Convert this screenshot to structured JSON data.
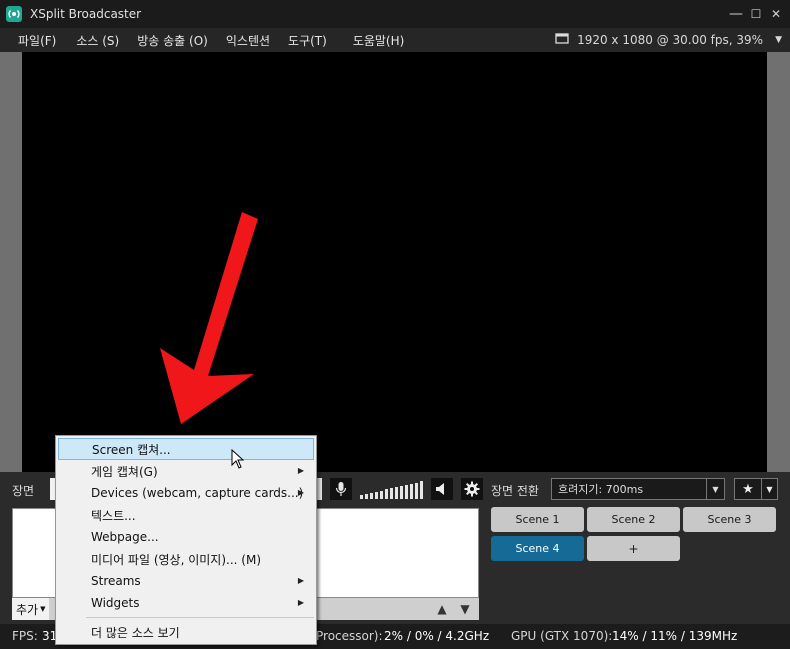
{
  "window": {
    "title": "XSplit Broadcaster",
    "controls": {
      "minimize": "—",
      "maximize": "☐",
      "close": "✕"
    }
  },
  "menu": {
    "items": [
      "파일(F)",
      "소스 (S)",
      "방송 송출 (O)",
      "익스텐션",
      "도구(T)",
      "도움말(H)"
    ],
    "resolution": "1920 x 1080 @ 30.00 fps, 39%"
  },
  "scenes": {
    "label": "장면",
    "buttons": [
      "Scene 1",
      "Scene 2",
      "Scene 3",
      "Scene 4",
      "+"
    ],
    "active": "Scene 4"
  },
  "sources": {
    "add_label": "추가"
  },
  "transition": {
    "label": "장면 전환",
    "value": "흐려지기: 700ms"
  },
  "context_menu": {
    "items": [
      {
        "label": "Screen 캡쳐...",
        "submenu": false
      },
      {
        "label": "게임 캡쳐(G)",
        "submenu": true
      },
      {
        "label": "Devices (webcam, capture cards...)",
        "submenu": true
      },
      {
        "label": "텍스트...",
        "submenu": false
      },
      {
        "label": "Webpage...",
        "submenu": false
      },
      {
        "label": "미디어 파일 (영상, 이미지)... (M)",
        "submenu": false
      },
      {
        "label": "Streams",
        "submenu": true
      },
      {
        "label": "Widgets",
        "submenu": true
      }
    ],
    "more_label": "더 많은 소스 보기",
    "highlighted": "Screen 캡쳐..."
  },
  "status": {
    "fps_label": "FPS:",
    "fps_value": "31",
    "cpu_label": "Processor):",
    "cpu_value": "2% / 0% / 4.2GHz",
    "gpu_label": "GPU (GTX 1070):",
    "gpu_value": "14% / 11% / 139MHz"
  },
  "colors": {
    "accent": "#156a96",
    "arrow": "#f0171a",
    "menu_highlight": "#cde8f7"
  },
  "icons": {
    "app": "xsplit-logo-icon",
    "resolution": "monitor-icon",
    "toolbar": [
      "microphone-icon",
      "volume-bars-icon",
      "speaker-icon",
      "gear-icon"
    ],
    "favorites": "star-add-icon"
  }
}
